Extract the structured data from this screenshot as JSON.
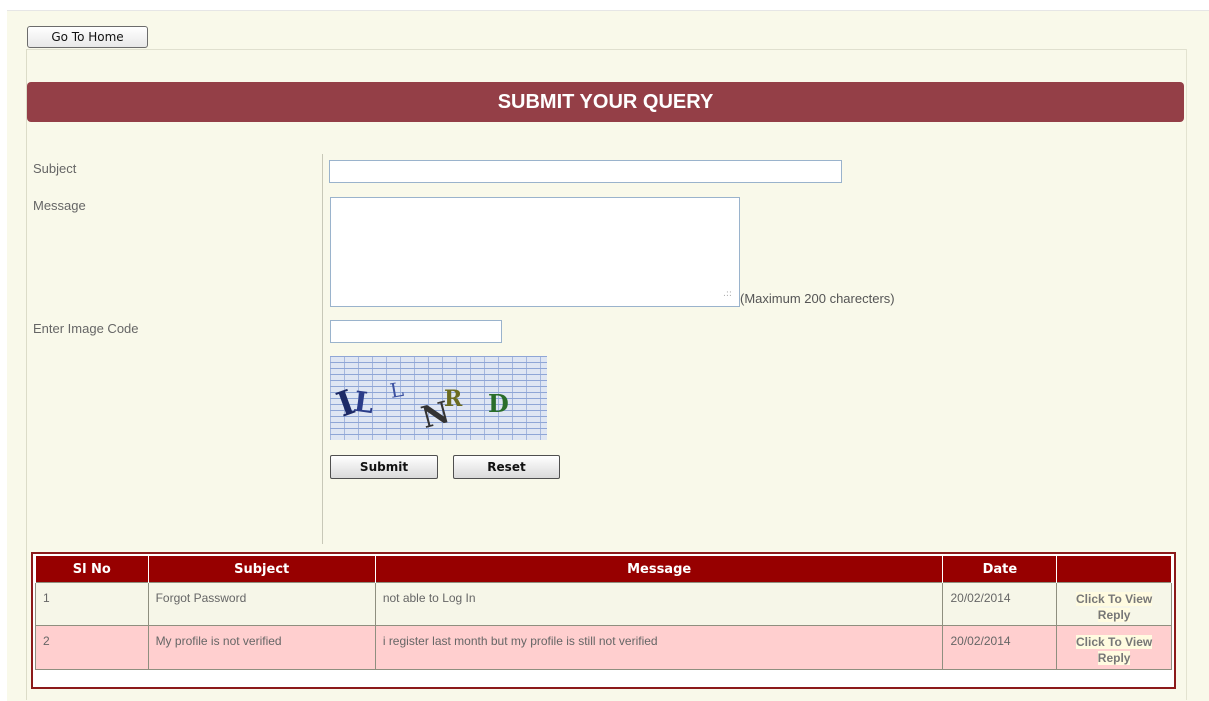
{
  "nav": {
    "home_label": "Go To Home"
  },
  "form": {
    "title": "SUBMIT YOUR QUERY",
    "subject_label": "Subject",
    "subject_value": "",
    "message_label": "Message",
    "message_value": "",
    "message_hint": "(Maximum 200 charecters)",
    "image_code_label": "Enter Image Code",
    "image_code_value": "",
    "captcha_letters": [
      "I",
      "L",
      "L",
      "N",
      "R",
      "D"
    ],
    "submit_label": "Submit",
    "reset_label": "Reset"
  },
  "table": {
    "headers": [
      "Sl No",
      "Subject",
      "Message",
      "Date",
      ""
    ],
    "rows": [
      {
        "sl": "1",
        "subject": "Forgot Password",
        "message": "not able to Log In",
        "date": "20/02/2014",
        "action": "Click To View Reply"
      },
      {
        "sl": "2",
        "subject": "My profile is not verified",
        "message": "i register last month but my profile is still not verified",
        "date": "20/02/2014",
        "action": "Click To View Reply"
      }
    ]
  },
  "colors": {
    "banner": "#943f47",
    "table_header": "#970000",
    "row_alt": "#ffcfcf",
    "panel_bg": "#f9f9ea"
  }
}
